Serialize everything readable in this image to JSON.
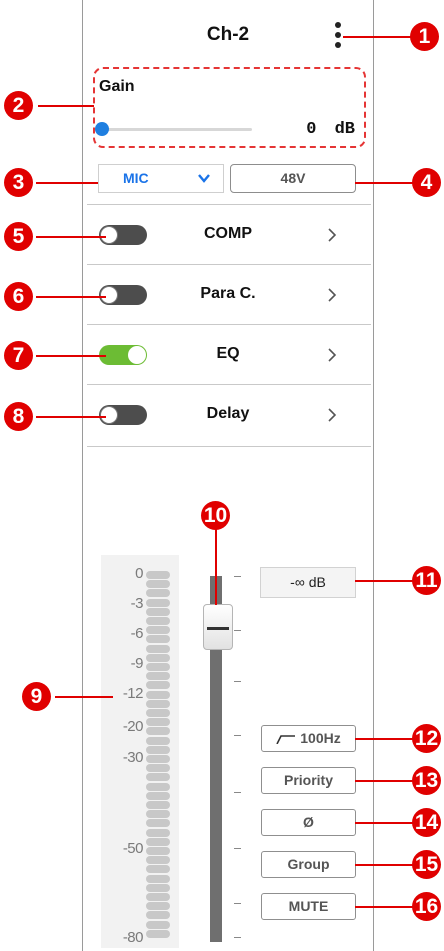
{
  "channel": {
    "title": "Ch-2"
  },
  "gain": {
    "label": "Gain",
    "value": "0",
    "unit": "dB",
    "level": 0
  },
  "input_select": {
    "selected": "MIC"
  },
  "phantom_button": {
    "label": "48V"
  },
  "rows": [
    {
      "label": "COMP",
      "enabled": false
    },
    {
      "label": "Para C.",
      "enabled": false
    },
    {
      "label": "EQ",
      "enabled": true
    },
    {
      "label": "Delay",
      "enabled": false
    }
  ],
  "meter": {
    "labels": [
      "0",
      "-3",
      "-6",
      "-9",
      "-12",
      "-20",
      "-30",
      "-50",
      "-80"
    ]
  },
  "fader": {
    "readout": "-∞ dB"
  },
  "buttons": {
    "hpf": "100Hz",
    "priority": "Priority",
    "phase": "Ø",
    "group": "Group",
    "mute": "MUTE"
  },
  "callouts": [
    "1",
    "2",
    "3",
    "4",
    "5",
    "6",
    "7",
    "8",
    "9",
    "10",
    "11",
    "12",
    "13",
    "14",
    "15",
    "16"
  ],
  "colors": {
    "accent_blue": "#1a73e8",
    "toggle_on": "#6cbc34",
    "toggle_off": "#4d4d4d",
    "callout_red": "#e00000"
  }
}
